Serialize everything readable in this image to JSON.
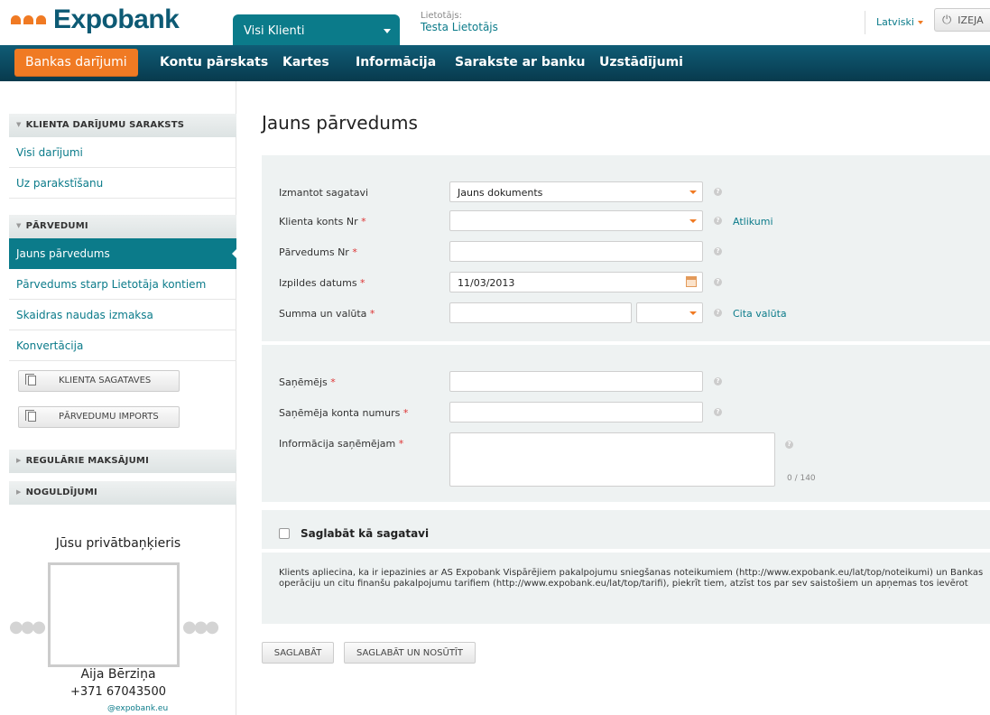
{
  "header": {
    "brand": "Expobank",
    "client_select": "Visi Klienti",
    "user_label": "Lietotājs:",
    "user_name": "Testa Lietotājs",
    "language": "Latviski",
    "logout": "IZEJA"
  },
  "nav": {
    "items": [
      {
        "label": "Bankas darījumi",
        "active": true
      },
      {
        "label": "Kontu pārskats"
      },
      {
        "label": "Kartes"
      },
      {
        "label": "Informācija"
      },
      {
        "label": "Sarakste ar banku"
      },
      {
        "label": "Uzstādījumi"
      }
    ]
  },
  "sidebar": {
    "sections": [
      {
        "title": "KLIENTA DARĪJUMU SARAKSTS",
        "items": [
          "Visi darījumi",
          "Uz parakstīšanu"
        ]
      },
      {
        "title": "PĀRVEDUMI",
        "items": [
          "Jauns pārvedums",
          "Pārvedums starp Lietotāja kontiem",
          "Skaidras naudas izmaksa",
          "Konvertācija"
        ]
      },
      {
        "title": "REGULĀRIE MAKSĀJUMI"
      },
      {
        "title": "NOGULDĪJUMI"
      }
    ],
    "active_item": "Jauns pārvedums",
    "buttons": [
      "KLIENTA SAGATAVES",
      "PĀRVEDUMU IMPORTS"
    ],
    "banker": {
      "title": "Jūsu privātbaņķieris",
      "name": "Aija Bērziņa",
      "phone": "+371 67043500",
      "email": "@expobank.eu"
    }
  },
  "main": {
    "title": "Jauns pārvedums",
    "fields": {
      "template": {
        "label": "Izmantot sagatavi",
        "value": "Jauns dokuments"
      },
      "account": {
        "label": "Klienta konts Nr",
        "required": "*",
        "value": "",
        "link": "Atlikumi"
      },
      "transfer_no": {
        "label": "Pārvedums Nr",
        "required": "*",
        "value": ""
      },
      "exec_date": {
        "label": "Izpildes datums",
        "required": "*",
        "value": "11/03/2013"
      },
      "amount": {
        "label": "Summa un valūta",
        "required": "*",
        "value": "",
        "currency": "",
        "link": "Cita valūta"
      },
      "beneficiary": {
        "label": "Saņēmējs",
        "required": "*",
        "value": ""
      },
      "beneficiary_account": {
        "label": "Saņēmēja konta numurs",
        "required": "*",
        "value": ""
      },
      "beneficiary_info": {
        "label": "Informācija saņēmējam",
        "required": "*",
        "value": "",
        "counter": "0 / 140"
      }
    },
    "save_template_label": "Saglabāt kā sagatavi",
    "save_template_checked": false,
    "notice": "Klients apliecina, ka ir iepazinies ar AS Expobank Vispārējiem pakalpojumu sniegšanas noteikumiem (http://www.expobank.eu/lat/top/noteikumi) un Bankas operāciju un citu finanšu pakalpojumu tarifiem (http://www.expobank.eu/lat/top/tarifi), piekrīt tiem, atzīst tos par sev saistošiem un apņemas tos ievērot",
    "buttons": {
      "save": "SAGLABĀT",
      "save_send": "SAGLABĀT UN NOSŪTĪT"
    }
  },
  "colors": {
    "accent": "#f07a23",
    "teal": "#0b7b8a",
    "nav": "#0d4c63",
    "panel": "#eef2f2"
  }
}
